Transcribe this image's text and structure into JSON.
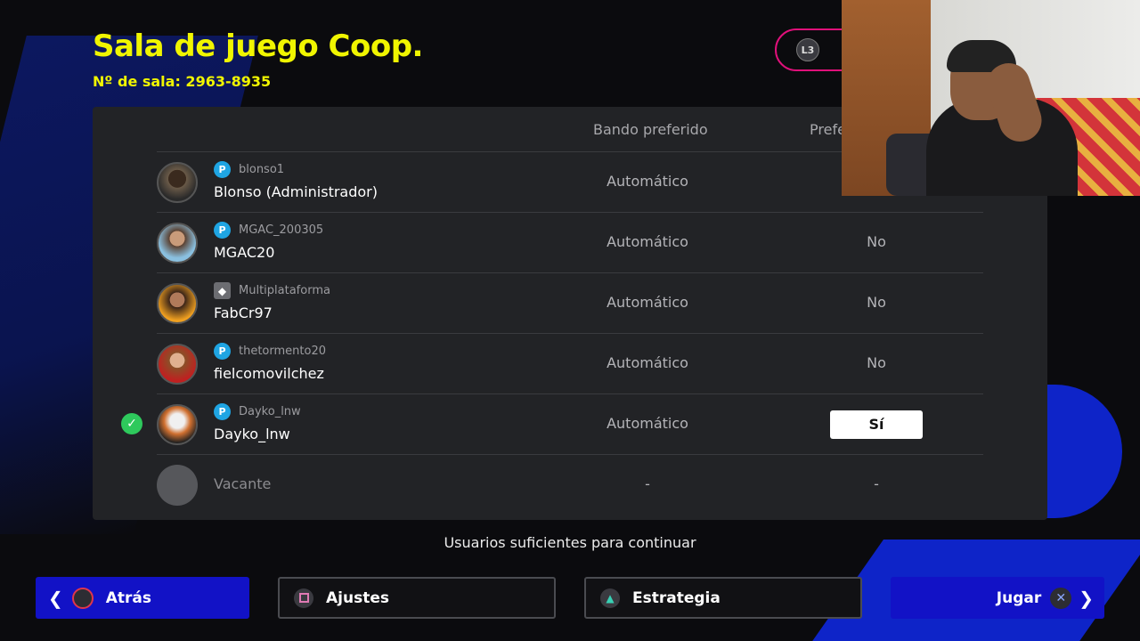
{
  "header": {
    "title": "Sala de juego Coop.",
    "room_line": "Nº de sala: 2963-8935",
    "l3_label": "L3"
  },
  "table": {
    "col_bando": "Bando preferido",
    "col_pref": "Prefe",
    "rows": [
      {
        "handle": "blonso1",
        "name": "Blonso (Administrador)",
        "bando": "Automático",
        "pref": "",
        "platform": "psn-icon",
        "checked": false
      },
      {
        "handle": "MGAC_200305",
        "name": "MGAC20",
        "bando": "Automático",
        "pref": "No",
        "platform": "psn-icon",
        "checked": false
      },
      {
        "handle": "Multiplataforma",
        "name": "FabCr97",
        "bando": "Automático",
        "pref": "No",
        "platform": "gamepad-icon",
        "checked": false
      },
      {
        "handle": "thetormento20",
        "name": "fielcomovilchez",
        "bando": "Automático",
        "pref": "No",
        "platform": "psn-icon",
        "checked": false
      },
      {
        "handle": "Dayko_lnw",
        "name": "Dayko_lnw",
        "bando": "Automático",
        "pref": "Sí",
        "platform": "psn-icon",
        "checked": true
      },
      {
        "name": "Vacante",
        "bando": "-",
        "pref": "-",
        "vacant": true
      }
    ]
  },
  "status": "Usuarios suficientes para continuar",
  "buttons": {
    "back": "Atrás",
    "settings": "Ajustes",
    "strategy": "Estrategia",
    "play": "Jugar"
  },
  "colors": {
    "title_yellow": "#f0f500",
    "primary_blue": "#1212c6",
    "accent_pink": "#e0107a",
    "check_green": "#2ec95c"
  }
}
